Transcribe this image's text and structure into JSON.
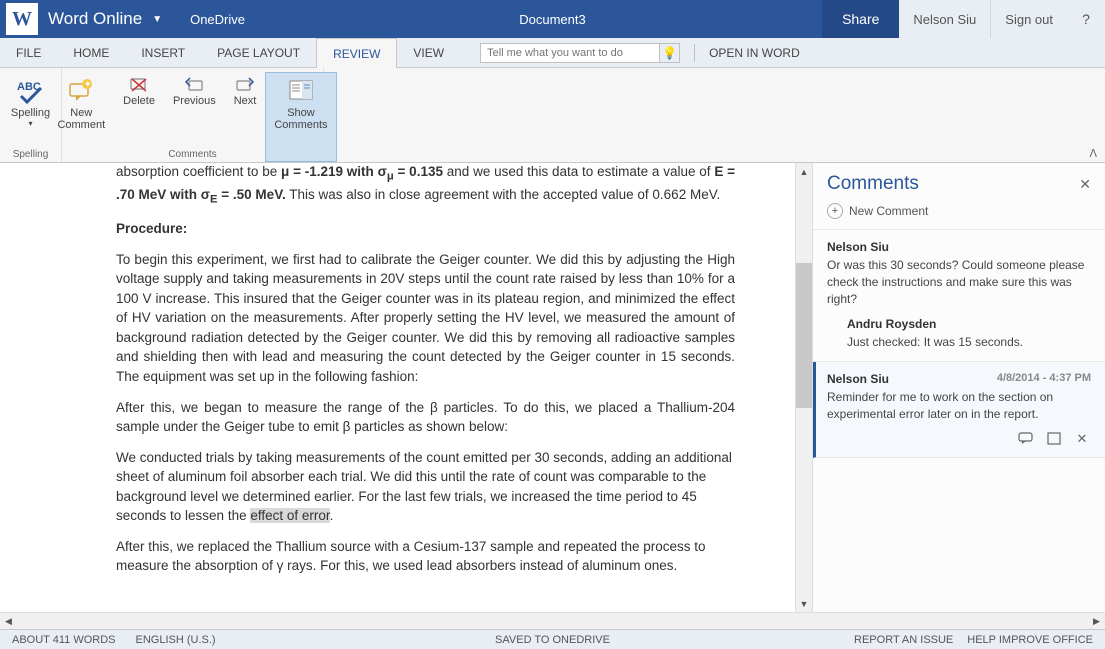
{
  "titlebar": {
    "app": "Word Online",
    "onedrive": "OneDrive",
    "doc": "Document3",
    "share": "Share",
    "user": "Nelson Siu",
    "signout": "Sign out",
    "help": "?"
  },
  "tabs": [
    "FILE",
    "HOME",
    "INSERT",
    "PAGE LAYOUT",
    "REVIEW",
    "VIEW"
  ],
  "tellme": "Tell me what you want to do",
  "openword": "OPEN IN WORD",
  "ribbon": {
    "spelling": {
      "btn": "Spelling",
      "group": "Spelling"
    },
    "comments": {
      "new1": "New",
      "new2": "Comment",
      "delete": "Delete",
      "prev": "Previous",
      "next": "Next",
      "show1": "Show",
      "show2": "Comments",
      "group": "Comments"
    }
  },
  "doc": {
    "line1a": "absorption coefficient to be ",
    "line1b": "μ = -1.219 with σ",
    "line1c": " = 0.135",
    "line1d": " and we used this data to estimate a value of ",
    "line1e": "E = .70 MeV with σ",
    "line1f": " = .50 MeV.",
    "line1g": " This was also in close agreement with the accepted value of 0.662 MeV.",
    "proc": "Procedure:",
    "p1": "To begin this experiment, we first had to calibrate the Geiger counter. We did this by adjusting the High voltage supply and taking measurements in 20V steps until the count rate raised by less than 10% for a 100 V increase. This insured that the Geiger counter was in its plateau region, and minimized the effect of HV variation on the measurements. After properly setting the HV level, we measured the amount of background radiation detected by the Geiger counter. We did this by removing all radioactive samples and shielding then with lead and measuring the count detected by the Geiger counter in 15 seconds. The equipment was set up in the following fashion:",
    "p2": "After this, we began to measure the range of the β particles. To do this, we placed a Thallium-204 sample under the Geiger tube to emit β particles as shown below:",
    "p3a": "We conducted trials by taking measurements of the count emitted per 30 seconds, adding an additional sheet of aluminum foil absorber each trial. We did this until the rate of count was comparable to the background level we determined earlier. For the last few trials, we increased the time period to 45 seconds to lessen the ",
    "p3b": "effect of error",
    "p3c": ".",
    "p4": "After this, we replaced the Thallium source with a Cesium-137 sample and repeated the process to measure the absorption of γ rays. For this, we used lead absorbers instead of aluminum ones."
  },
  "comments": {
    "title": "Comments",
    "new": "New Comment",
    "threads": [
      {
        "author": "Nelson Siu",
        "text": "Or was this 30 seconds?  Could someone please check the instructions and make sure this was right?",
        "replies": [
          {
            "author": "Andru Roysden",
            "text": "Just checked: It was 15 seconds."
          }
        ]
      },
      {
        "author": "Nelson Siu",
        "time": "4/8/2014 - 4:37 PM",
        "text": "Reminder for me to work on the section on experimental error later on in the report.",
        "selected": true
      }
    ]
  },
  "status": {
    "words": "ABOUT 411 WORDS",
    "lang": "ENGLISH (U.S.)",
    "saved": "SAVED TO ONEDRIVE",
    "issue": "REPORT AN ISSUE",
    "help": "HELP IMPROVE OFFICE"
  }
}
